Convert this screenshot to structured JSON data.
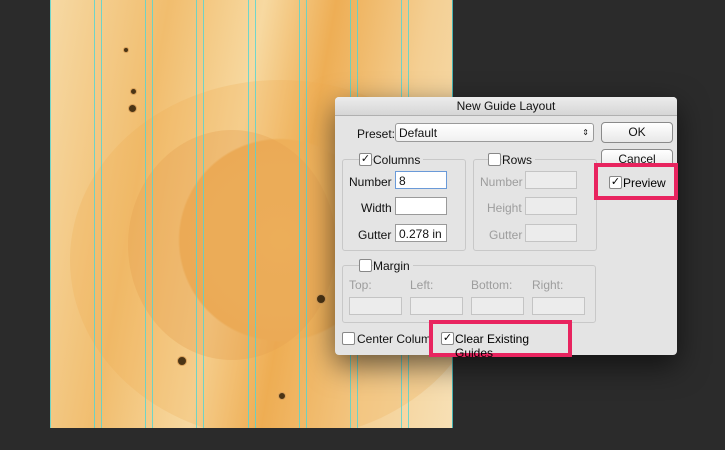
{
  "dialog": {
    "title": "New Guide Layout",
    "preset": {
      "label": "Preset:",
      "value": "Default"
    },
    "ok_label": "OK",
    "cancel_label": "Cancel",
    "preview": {
      "label": "Preview",
      "checked": true
    },
    "columns": {
      "label": "Columns",
      "checked": true,
      "number_label": "Number",
      "number_value": "8",
      "width_label": "Width",
      "width_value": "",
      "gutter_label": "Gutter",
      "gutter_value": "0.278 in"
    },
    "rows": {
      "label": "Rows",
      "checked": false,
      "number_label": "Number",
      "height_label": "Height",
      "gutter_label": "Gutter"
    },
    "margin": {
      "label": "Margin",
      "checked": false,
      "top_label": "Top:",
      "left_label": "Left:",
      "bottom_label": "Bottom:",
      "right_label": "Right:"
    },
    "center_columns": {
      "label": "Center Columns",
      "checked": false
    },
    "clear_guides": {
      "label": "Clear Existing Guides",
      "checked": true
    }
  },
  "colors": {
    "highlight": "#e8245f",
    "guide": "#4fd6d6"
  },
  "check_glyph": "✓"
}
